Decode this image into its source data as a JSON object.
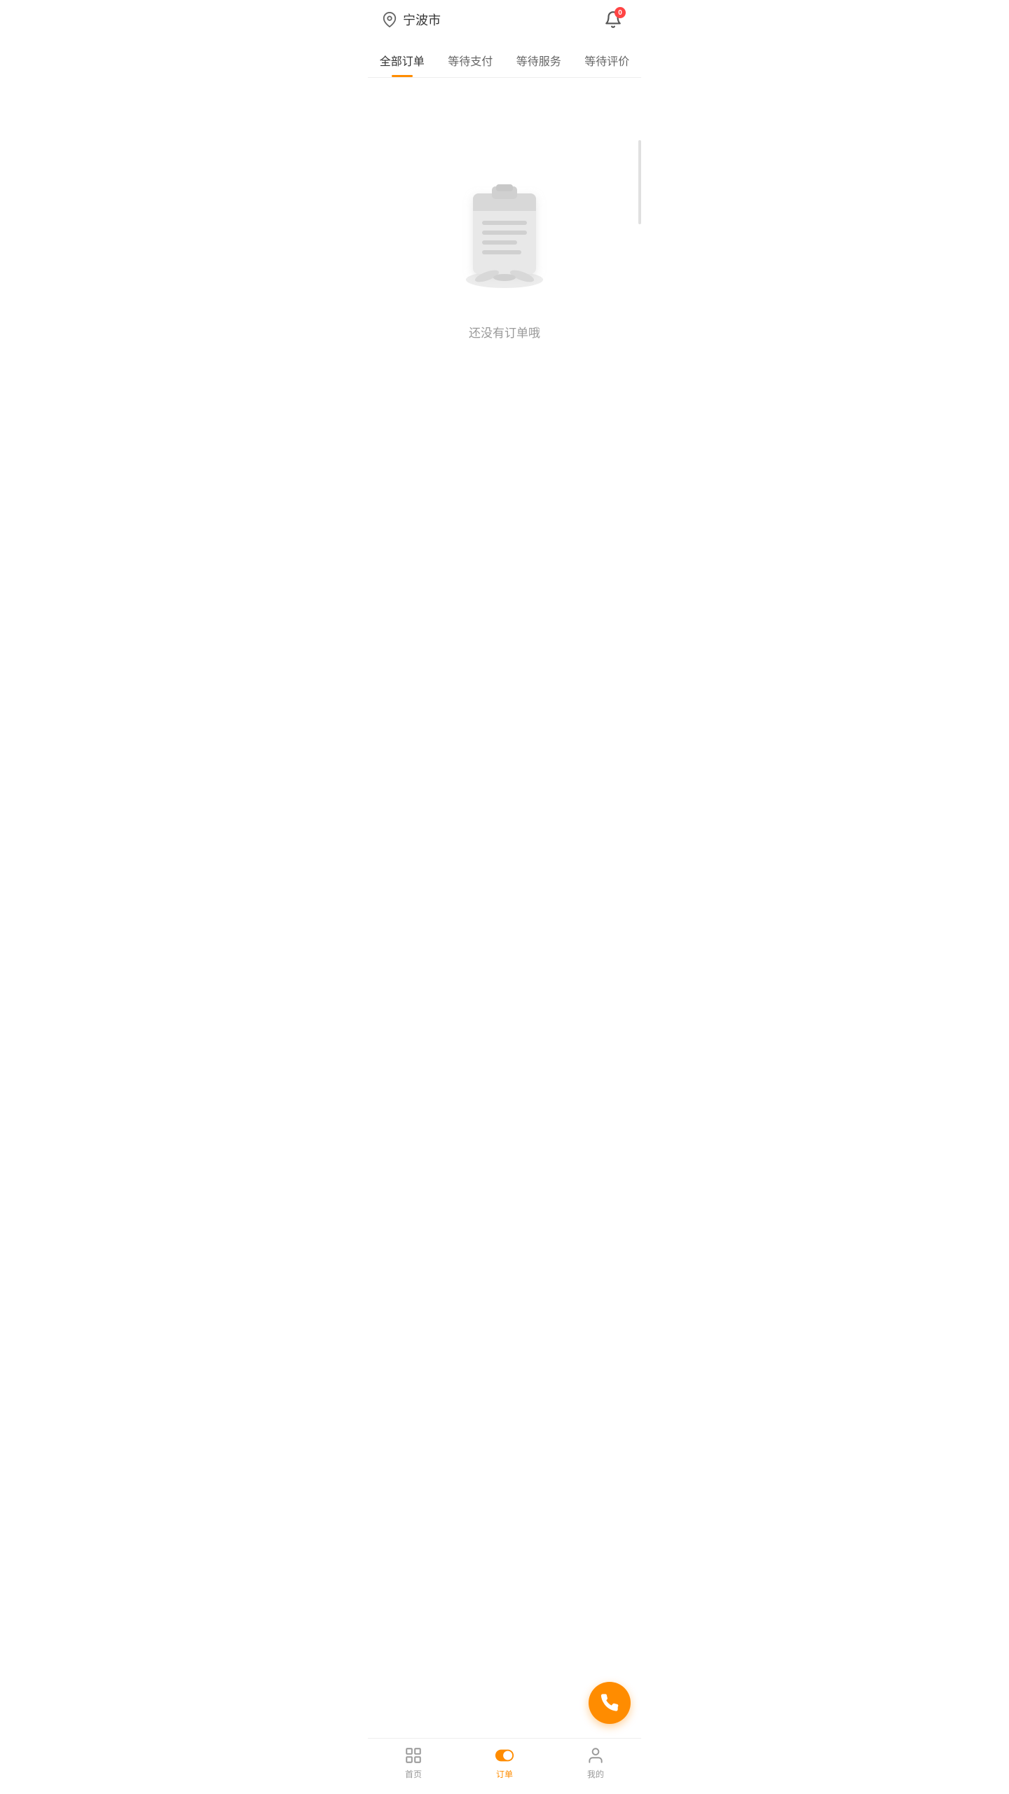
{
  "header": {
    "city": "宁波市",
    "notification_badge": "0"
  },
  "tabs": [
    {
      "id": "all",
      "label": "全部订单",
      "active": true
    },
    {
      "id": "pending-pay",
      "label": "等待支付",
      "active": false
    },
    {
      "id": "pending-service",
      "label": "等待服务",
      "active": false
    },
    {
      "id": "pending-review",
      "label": "等待评价",
      "active": false
    }
  ],
  "empty_state": {
    "message": "还没有订单哦"
  },
  "bottom_nav": [
    {
      "id": "home",
      "label": "首页",
      "active": false
    },
    {
      "id": "order",
      "label": "订单",
      "active": true
    },
    {
      "id": "mine",
      "label": "我的",
      "active": false
    }
  ],
  "colors": {
    "accent": "#ff8c00",
    "text_primary": "#333",
    "text_secondary": "#666",
    "text_muted": "#999",
    "badge_red": "#ff4444"
  }
}
